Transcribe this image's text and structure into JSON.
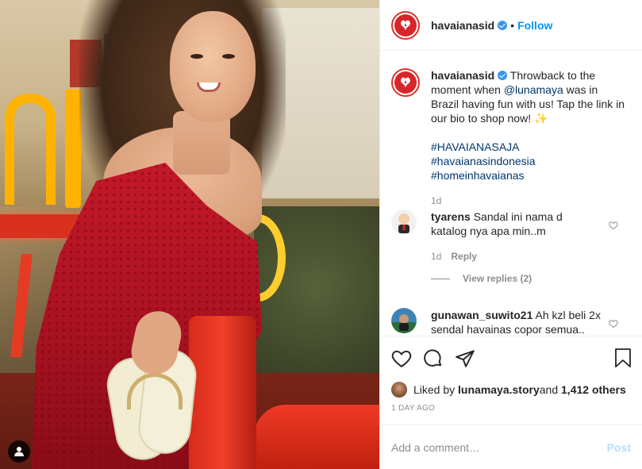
{
  "account": {
    "username": "havaianasid",
    "follow_label": "Follow",
    "dot": "•"
  },
  "caption": {
    "username": "havaianasid",
    "text_before_mention": "Throwback to the moment when ",
    "mention": "@lunamaya",
    "text_after_mention": " was in Brazil having fun with us! Tap the link in our bio to shop now! ",
    "emoji": "✨",
    "hashtags": [
      "#HAVAIANASAJA",
      "#havaianasindonesia",
      "#homeinhavaianas"
    ],
    "time": "1d"
  },
  "comments": [
    {
      "username": "tyarens",
      "text": "Sandal ini nama d katalog nya apa min..m",
      "time": "1d",
      "reply_label": "Reply",
      "view_replies": "View replies (2)"
    },
    {
      "username": "gunawan_suwito21",
      "text": "Ah kzl beli 2x sendal havainas copor semua.."
    }
  ],
  "likes": {
    "prefix": "Liked by ",
    "user": "lunamaya.story",
    "and": " and ",
    "others": "1,412 others"
  },
  "timestamp": "1 DAY AGO",
  "add_comment": {
    "placeholder": "Add a comment…",
    "post_label": "Post"
  },
  "colors": {
    "brand_red": "#d7262a",
    "link_blue": "#0095f6",
    "hashtag_navy": "#00376b",
    "muted_gray": "#8e8e8e",
    "post_disabled": "#b2dffc"
  },
  "icons": [
    "havaianas-logo-icon",
    "verified-badge-icon",
    "heart-icon",
    "comment-icon",
    "share-icon",
    "bookmark-icon",
    "user-tag-icon"
  ]
}
